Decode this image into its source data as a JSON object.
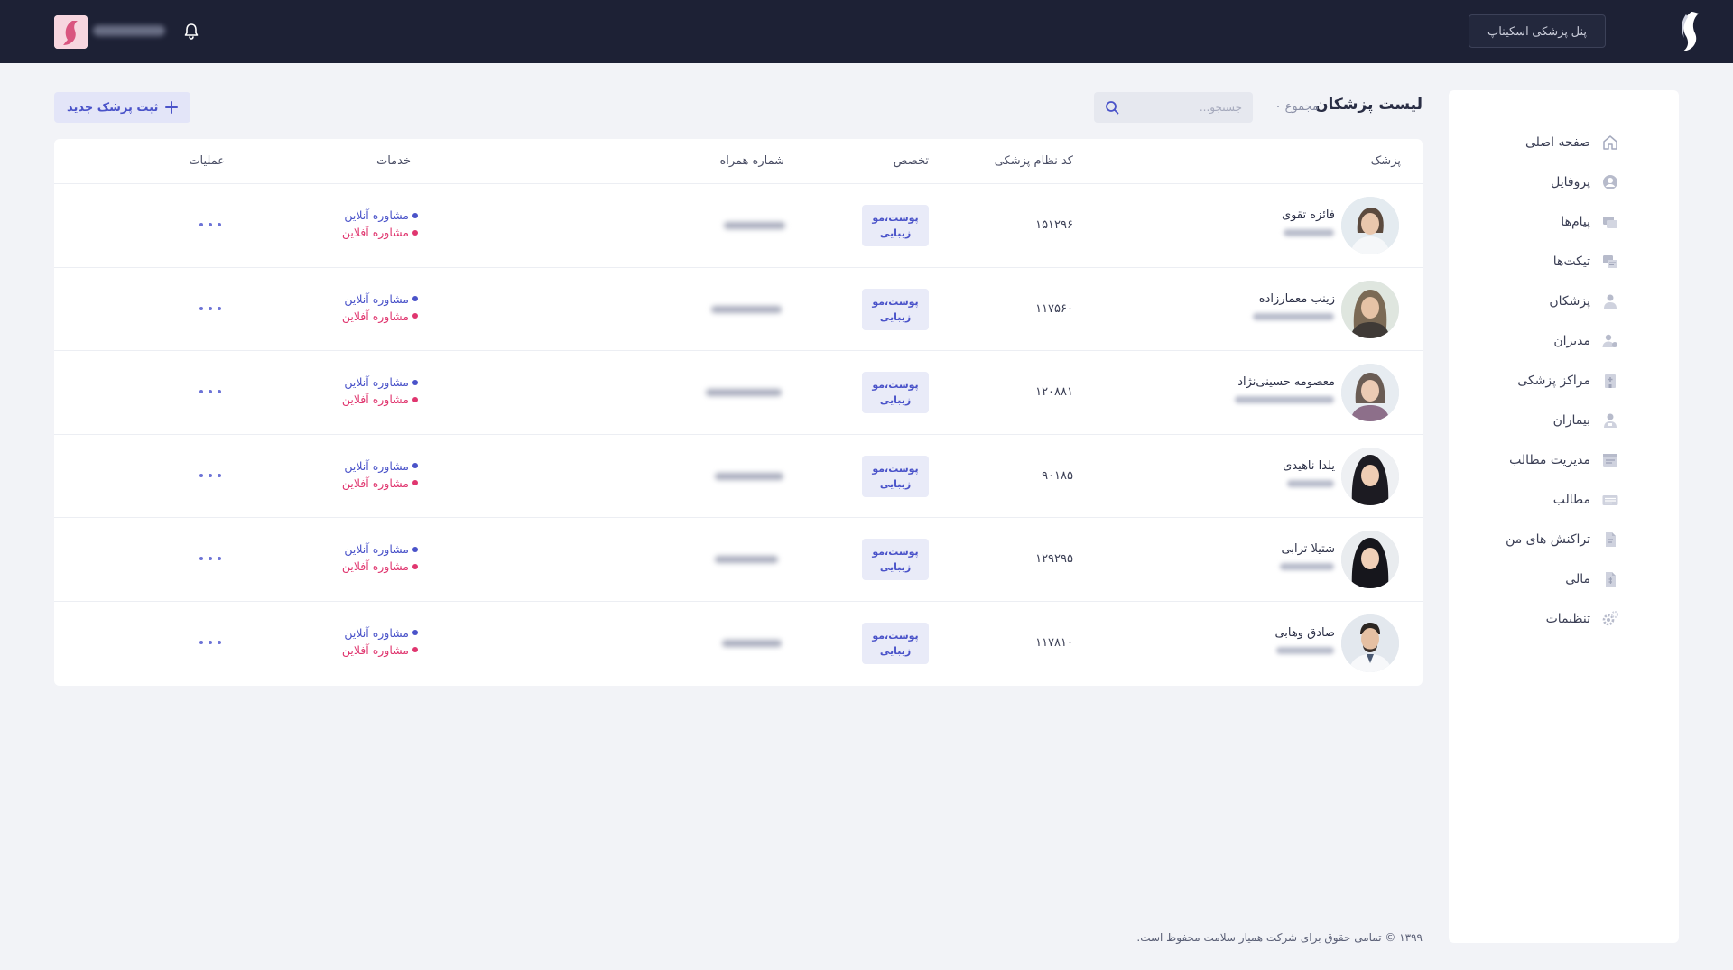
{
  "topbar": {
    "panel_button": "پنل پزشکی اسکیناپ"
  },
  "sidebar": {
    "items": [
      {
        "label": "صفحه اصلی",
        "icon": "home-icon"
      },
      {
        "label": "پروفایل",
        "icon": "profile-icon"
      },
      {
        "label": "پیام‌ها",
        "icon": "messages-icon"
      },
      {
        "label": "تیکت‌ها",
        "icon": "tickets-icon"
      },
      {
        "label": "پزشکان",
        "icon": "doctor-icon"
      },
      {
        "label": "مدیران",
        "icon": "managers-icon"
      },
      {
        "label": "مراکز پزشکی",
        "icon": "clinic-icon"
      },
      {
        "label": "بیماران",
        "icon": "patients-icon"
      },
      {
        "label": "مدیریت مطالب",
        "icon": "content-management-icon"
      },
      {
        "label": "مطالب",
        "icon": "articles-icon"
      },
      {
        "label": "تراکنش های من",
        "icon": "transactions-icon"
      },
      {
        "label": "مالی",
        "icon": "finance-icon"
      },
      {
        "label": "تنظیمات",
        "icon": "settings-icon"
      }
    ]
  },
  "page": {
    "title": "لیست پزشکان",
    "total": "مجموع ۰",
    "search_placeholder": "جستجو...",
    "add_button": "ثبت پزشک جدید"
  },
  "table": {
    "columns": {
      "doctor": "پزشک",
      "code": "کد نظام پزشکی",
      "specialty": "تخصص",
      "mobile": "شماره همراه",
      "services": "خدمات",
      "operations": "عملیات"
    },
    "rows": [
      {
        "name": "فائزه تقوی",
        "code": "۱۵۱۲۹۶",
        "specialty_1": "پوست،مو",
        "specialty_2": "زیبایی",
        "service_online": "مشاوره آنلاین",
        "service_offline": "مشاوره آفلاین"
      },
      {
        "name": "زینب معمارزاده",
        "code": "۱۱۷۵۶۰",
        "specialty_1": "پوست،مو",
        "specialty_2": "زیبایی",
        "service_online": "مشاوره آنلاین",
        "service_offline": "مشاوره آفلاین"
      },
      {
        "name": "معصومه حسینی‌نژاد",
        "code": "۱۲۰۸۸۱",
        "specialty_1": "پوست،مو",
        "specialty_2": "زیبایی",
        "service_online": "مشاوره آنلاین",
        "service_offline": "مشاوره آفلاین"
      },
      {
        "name": "یلدا ناهیدی",
        "code": "۹۰۱۸۵",
        "specialty_1": "پوست،مو",
        "specialty_2": "زیبایی",
        "service_online": "مشاوره آنلاین",
        "service_offline": "مشاوره آفلاین"
      },
      {
        "name": "شتیلا ترابی",
        "code": "۱۲۹۲۹۵",
        "specialty_1": "پوست،مو",
        "specialty_2": "زیبایی",
        "service_online": "مشاوره آنلاین",
        "service_offline": "مشاوره آفلاین"
      },
      {
        "name": "صادق وهابی",
        "code": "۱۱۷۸۱۰",
        "specialty_1": "پوست،مو",
        "specialty_2": "زیبایی",
        "service_online": "مشاوره آنلاین",
        "service_offline": "مشاوره آفلاین"
      }
    ]
  },
  "footer": {
    "copyright": "۱۳۹۹ © تمامی حقوق برای شرکت همیار سلامت محفوظ است."
  },
  "colors": {
    "topbar": "#1d2135",
    "accent": "#4a53c9",
    "offline": "#e0366f",
    "background": "#f2f3f7"
  }
}
